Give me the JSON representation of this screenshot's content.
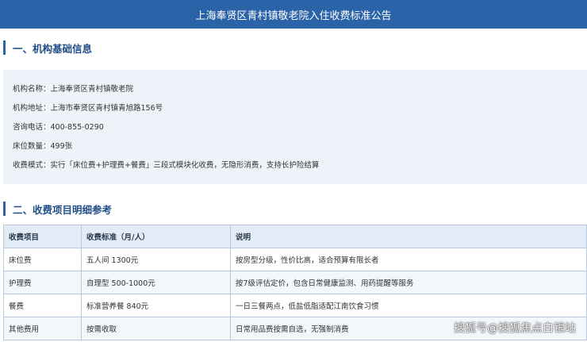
{
  "banner": {
    "title": "上海奉贤区青村镇敬老院入住收费标准公告"
  },
  "section1": {
    "title": "一、机构基础信息",
    "rows": [
      "机构名称：上海奉贤区青村镇敬老院",
      "机构地址：上海市奉贤区青村镇青旭路156号",
      "咨询电话：400-855-0290",
      "床位数量：499张",
      "收费模式：实行「床位费+护理费+餐费」三段式模块化收费，无隐形消费，支持长护险结算"
    ]
  },
  "section2": {
    "title": "二、收费项目明细参考",
    "headers": [
      "收费项目",
      "收费标准（月/人）",
      "说明"
    ],
    "rows": [
      [
        "床位费",
        "五人间 1300元",
        "按房型分级，性价比高，适合预算有限长者"
      ],
      [
        "护理费",
        "自理型 500-1000元",
        "按7级评估定价，包含日常健康监测、用药提醒等服务"
      ],
      [
        "餐费",
        "标准营养餐 840元",
        "一日三餐两点，低盐低脂适配江南饮食习惯"
      ],
      [
        "其他费用",
        "按需收取",
        "日常用品费按需自选，无强制消费"
      ]
    ]
  },
  "watermark": "搜狐号@搜狐焦点白银站",
  "colors": {
    "accent": "#2a63a8",
    "panel": "#eef3f9"
  }
}
